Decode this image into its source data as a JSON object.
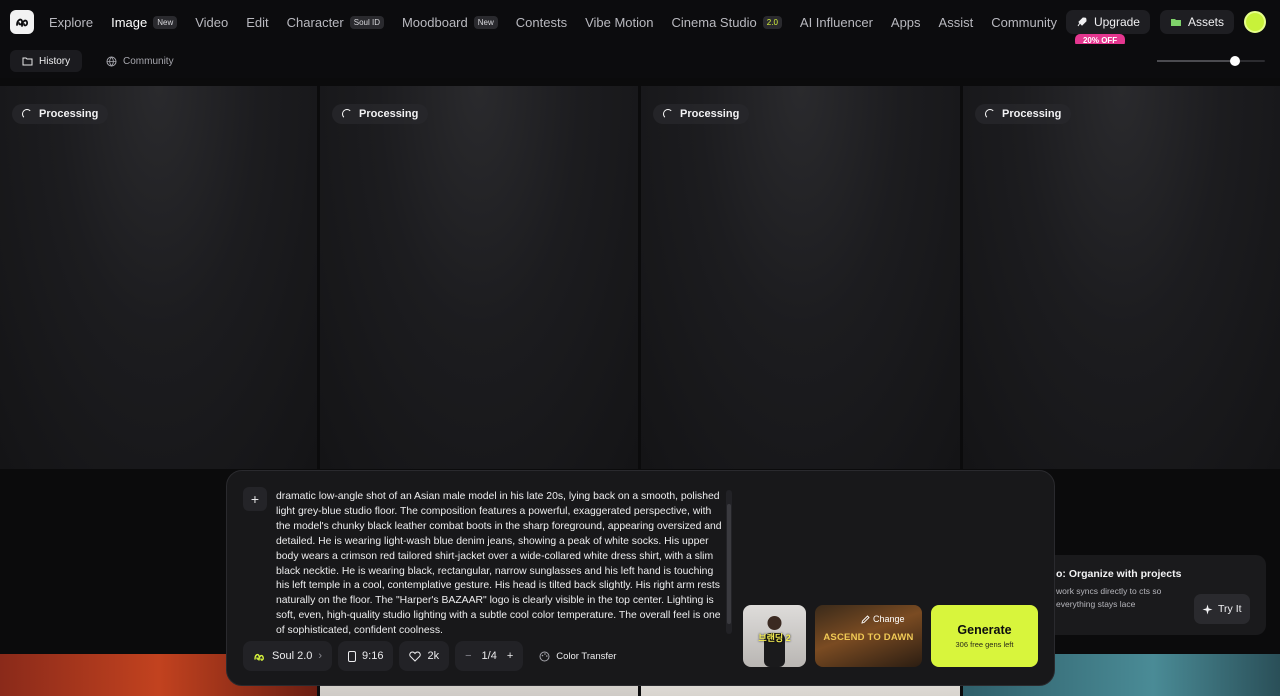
{
  "nav": {
    "items": [
      {
        "label": "Explore",
        "badge": ""
      },
      {
        "label": "Image",
        "badge": "New"
      },
      {
        "label": "Video",
        "badge": ""
      },
      {
        "label": "Edit",
        "badge": ""
      },
      {
        "label": "Character",
        "badge": "Soul ID"
      },
      {
        "label": "Moodboard",
        "badge": "New"
      },
      {
        "label": "Contests",
        "badge": ""
      },
      {
        "label": "Vibe Motion",
        "badge": ""
      },
      {
        "label": "Cinema Studio",
        "badge": "2.0"
      },
      {
        "label": "AI Influencer",
        "badge": ""
      },
      {
        "label": "Apps",
        "badge": ""
      },
      {
        "label": "Assist",
        "badge": ""
      },
      {
        "label": "Community",
        "badge": ""
      }
    ],
    "upgrade_label": "Upgrade",
    "upgrade_promo": "20% OFF",
    "assets_label": "Assets"
  },
  "subbar": {
    "history_label": "History",
    "community_label": "Community",
    "zoom_level": 0.72
  },
  "cards": [
    {
      "status": "Processing"
    },
    {
      "status": "Processing"
    },
    {
      "status": "Processing"
    },
    {
      "status": "Processing"
    }
  ],
  "prompt": {
    "text": "dramatic low-angle shot of an Asian male model in his late 20s, lying back on a smooth, polished light grey-blue studio floor. The composition features a powerful, exaggerated perspective, with the model's chunky black leather combat boots in the sharp foreground, appearing oversized and detailed. He is wearing light-wash blue denim jeans, showing a peak of white socks. His upper body wears a crimson red tailored shirt-jacket over a wide-collared white dress shirt, with a slim black necktie. He is wearing black, rectangular, narrow sunglasses and his left hand is touching his left temple in a cool, contemplative gesture. His head is tilted back slightly. His right arm rests naturally on the floor. The \"Harper's BAZAAR\" logo is clearly visible in the top center. Lighting is soft, even, high-quality studio lighting with a subtle cool color temperature. The overall feel is one of sophisticated, confident coolness."
  },
  "controls": {
    "model": "Soul 2.0",
    "aspect_ratio": "9:16",
    "quality": "2k",
    "batch": "1/4",
    "color_transfer": "Color Transfer"
  },
  "presets": {
    "preset1_caption": "브랜딩 2",
    "preset2_title": "ASCEND TO DAWN",
    "change_label": "Change"
  },
  "generate": {
    "label": "Generate",
    "sub": "306 free gens left"
  },
  "toast": {
    "title": "o: Organize with projects",
    "body": "work syncs directly to cts so everything stays lace",
    "button": "Try It"
  },
  "colors": {
    "accent": "#d8f53c",
    "promo": "#e5368f"
  }
}
